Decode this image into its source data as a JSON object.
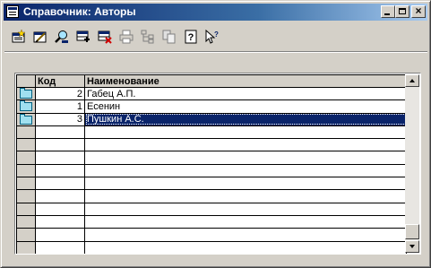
{
  "window": {
    "title": "Справочник: Авторы",
    "controls": {
      "minimize": "_",
      "maximize": "□",
      "close": "×"
    }
  },
  "toolbar": {
    "buttons": [
      {
        "icon": "new-record-icon"
      },
      {
        "icon": "edit-record-icon"
      },
      {
        "icon": "find-icon"
      },
      {
        "icon": "add-row-icon"
      },
      {
        "icon": "delete-row-icon"
      },
      {
        "icon": "print-icon"
      },
      {
        "icon": "hierarchy-icon"
      },
      {
        "icon": "copy-icon"
      },
      {
        "icon": "help-icon"
      },
      {
        "icon": "context-help-icon"
      }
    ]
  },
  "table": {
    "columns": [
      "Код",
      "Наименование"
    ],
    "rows": [
      {
        "code": "2",
        "name": "Габец А.П."
      },
      {
        "code": "1",
        "name": "Есенин"
      },
      {
        "code": "3",
        "name": "Пушкин А.С."
      }
    ],
    "selected_row": 2
  },
  "colors": {
    "title_start": "#0a246a",
    "title_end": "#a6caf0",
    "selection": "#0a246a",
    "window_face": "#d4d0c8",
    "folder": "#a0e0f0"
  }
}
